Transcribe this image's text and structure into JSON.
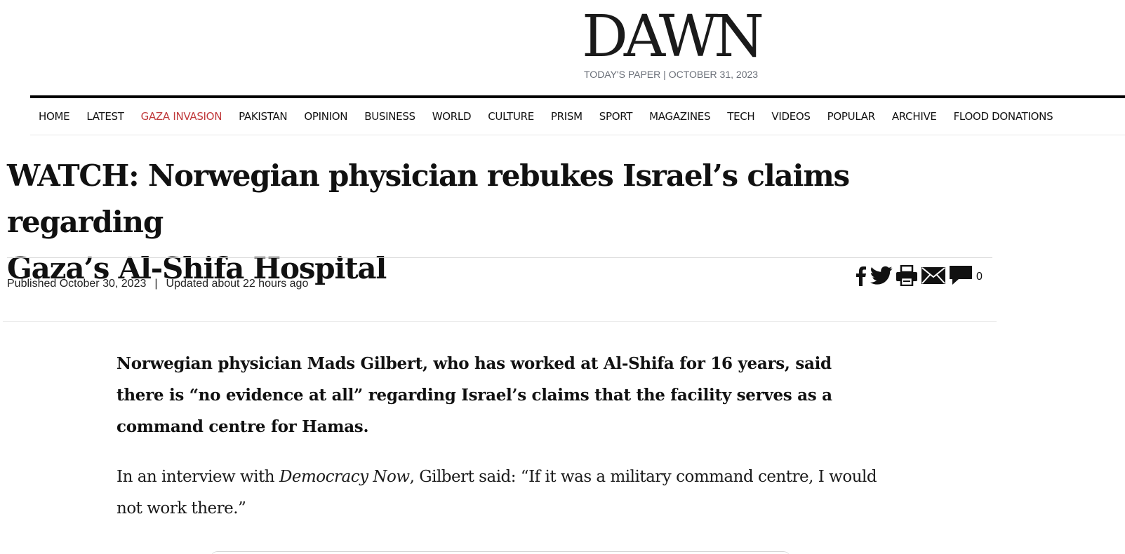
{
  "masthead": {
    "logo": "DAWN",
    "todays_paper": "TODAY'S PAPER",
    "separator": "|",
    "date": "OCTOBER 31, 2023"
  },
  "nav": {
    "items": [
      {
        "label": "HOME"
      },
      {
        "label": "LATEST"
      },
      {
        "label": "GAZA INVASION",
        "active": true,
        "color": "#c0393b"
      },
      {
        "label": "PAKISTAN"
      },
      {
        "label": "OPINION"
      },
      {
        "label": "BUSINESS"
      },
      {
        "label": "WORLD"
      },
      {
        "label": "CULTURE"
      },
      {
        "label": "PRISM"
      },
      {
        "label": "SPORT"
      },
      {
        "label": "MAGAZINES"
      },
      {
        "label": "TECH"
      },
      {
        "label": "VIDEOS"
      },
      {
        "label": "POPULAR"
      },
      {
        "label": "ARCHIVE"
      },
      {
        "label": "FLOOD DONATIONS"
      }
    ]
  },
  "article": {
    "headline_line1": "WATCH: Norwegian physician rebukes Israel’s claims regarding",
    "headline_line2": "Gaza’s Al-Shifa Hospital",
    "published": "Published October 30, 2023",
    "byline_sep": "|",
    "updated": "Updated about 22 hours ago",
    "comment_count": "0",
    "excerpt": "Norwegian physician Mads Gilbert, who has worked at Al-Shifa for 16 years, said there is “no evidence at all” regarding Israel’s claims that the facility serves as a command centre for Hamas.",
    "para_before": "In an interview with ",
    "para_source": "Democracy Now",
    "para_after": ", Gilbert said: “If it was a military command centre, I would not work there.”"
  },
  "share_icons": [
    "facebook-icon",
    "twitter-icon",
    "print-icon",
    "email-icon",
    "comment-icon"
  ]
}
